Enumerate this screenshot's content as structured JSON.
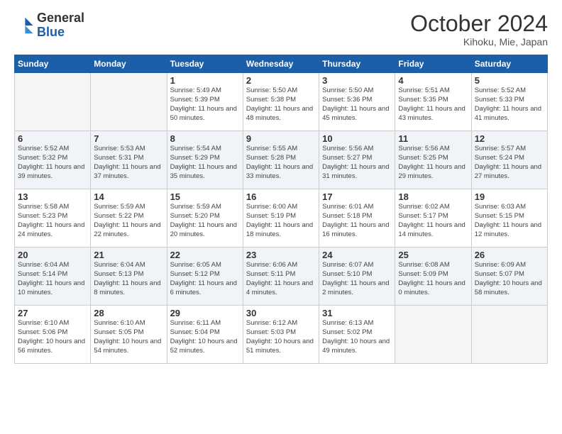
{
  "header": {
    "logo_general": "General",
    "logo_blue": "Blue",
    "month_title": "October 2024",
    "location": "Kihoku, Mie, Japan"
  },
  "days_of_week": [
    "Sunday",
    "Monday",
    "Tuesday",
    "Wednesday",
    "Thursday",
    "Friday",
    "Saturday"
  ],
  "weeks": [
    {
      "shade": false,
      "days": [
        {
          "num": "",
          "info": ""
        },
        {
          "num": "",
          "info": ""
        },
        {
          "num": "1",
          "info": "Sunrise: 5:49 AM\nSunset: 5:39 PM\nDaylight: 11 hours and 50 minutes."
        },
        {
          "num": "2",
          "info": "Sunrise: 5:50 AM\nSunset: 5:38 PM\nDaylight: 11 hours and 48 minutes."
        },
        {
          "num": "3",
          "info": "Sunrise: 5:50 AM\nSunset: 5:36 PM\nDaylight: 11 hours and 45 minutes."
        },
        {
          "num": "4",
          "info": "Sunrise: 5:51 AM\nSunset: 5:35 PM\nDaylight: 11 hours and 43 minutes."
        },
        {
          "num": "5",
          "info": "Sunrise: 5:52 AM\nSunset: 5:33 PM\nDaylight: 11 hours and 41 minutes."
        }
      ]
    },
    {
      "shade": true,
      "days": [
        {
          "num": "6",
          "info": "Sunrise: 5:52 AM\nSunset: 5:32 PM\nDaylight: 11 hours and 39 minutes."
        },
        {
          "num": "7",
          "info": "Sunrise: 5:53 AM\nSunset: 5:31 PM\nDaylight: 11 hours and 37 minutes."
        },
        {
          "num": "8",
          "info": "Sunrise: 5:54 AM\nSunset: 5:29 PM\nDaylight: 11 hours and 35 minutes."
        },
        {
          "num": "9",
          "info": "Sunrise: 5:55 AM\nSunset: 5:28 PM\nDaylight: 11 hours and 33 minutes."
        },
        {
          "num": "10",
          "info": "Sunrise: 5:56 AM\nSunset: 5:27 PM\nDaylight: 11 hours and 31 minutes."
        },
        {
          "num": "11",
          "info": "Sunrise: 5:56 AM\nSunset: 5:25 PM\nDaylight: 11 hours and 29 minutes."
        },
        {
          "num": "12",
          "info": "Sunrise: 5:57 AM\nSunset: 5:24 PM\nDaylight: 11 hours and 27 minutes."
        }
      ]
    },
    {
      "shade": false,
      "days": [
        {
          "num": "13",
          "info": "Sunrise: 5:58 AM\nSunset: 5:23 PM\nDaylight: 11 hours and 24 minutes."
        },
        {
          "num": "14",
          "info": "Sunrise: 5:59 AM\nSunset: 5:22 PM\nDaylight: 11 hours and 22 minutes."
        },
        {
          "num": "15",
          "info": "Sunrise: 5:59 AM\nSunset: 5:20 PM\nDaylight: 11 hours and 20 minutes."
        },
        {
          "num": "16",
          "info": "Sunrise: 6:00 AM\nSunset: 5:19 PM\nDaylight: 11 hours and 18 minutes."
        },
        {
          "num": "17",
          "info": "Sunrise: 6:01 AM\nSunset: 5:18 PM\nDaylight: 11 hours and 16 minutes."
        },
        {
          "num": "18",
          "info": "Sunrise: 6:02 AM\nSunset: 5:17 PM\nDaylight: 11 hours and 14 minutes."
        },
        {
          "num": "19",
          "info": "Sunrise: 6:03 AM\nSunset: 5:15 PM\nDaylight: 11 hours and 12 minutes."
        }
      ]
    },
    {
      "shade": true,
      "days": [
        {
          "num": "20",
          "info": "Sunrise: 6:04 AM\nSunset: 5:14 PM\nDaylight: 11 hours and 10 minutes."
        },
        {
          "num": "21",
          "info": "Sunrise: 6:04 AM\nSunset: 5:13 PM\nDaylight: 11 hours and 8 minutes."
        },
        {
          "num": "22",
          "info": "Sunrise: 6:05 AM\nSunset: 5:12 PM\nDaylight: 11 hours and 6 minutes."
        },
        {
          "num": "23",
          "info": "Sunrise: 6:06 AM\nSunset: 5:11 PM\nDaylight: 11 hours and 4 minutes."
        },
        {
          "num": "24",
          "info": "Sunrise: 6:07 AM\nSunset: 5:10 PM\nDaylight: 11 hours and 2 minutes."
        },
        {
          "num": "25",
          "info": "Sunrise: 6:08 AM\nSunset: 5:09 PM\nDaylight: 11 hours and 0 minutes."
        },
        {
          "num": "26",
          "info": "Sunrise: 6:09 AM\nSunset: 5:07 PM\nDaylight: 10 hours and 58 minutes."
        }
      ]
    },
    {
      "shade": false,
      "days": [
        {
          "num": "27",
          "info": "Sunrise: 6:10 AM\nSunset: 5:06 PM\nDaylight: 10 hours and 56 minutes."
        },
        {
          "num": "28",
          "info": "Sunrise: 6:10 AM\nSunset: 5:05 PM\nDaylight: 10 hours and 54 minutes."
        },
        {
          "num": "29",
          "info": "Sunrise: 6:11 AM\nSunset: 5:04 PM\nDaylight: 10 hours and 52 minutes."
        },
        {
          "num": "30",
          "info": "Sunrise: 6:12 AM\nSunset: 5:03 PM\nDaylight: 10 hours and 51 minutes."
        },
        {
          "num": "31",
          "info": "Sunrise: 6:13 AM\nSunset: 5:02 PM\nDaylight: 10 hours and 49 minutes."
        },
        {
          "num": "",
          "info": ""
        },
        {
          "num": "",
          "info": ""
        }
      ]
    }
  ]
}
